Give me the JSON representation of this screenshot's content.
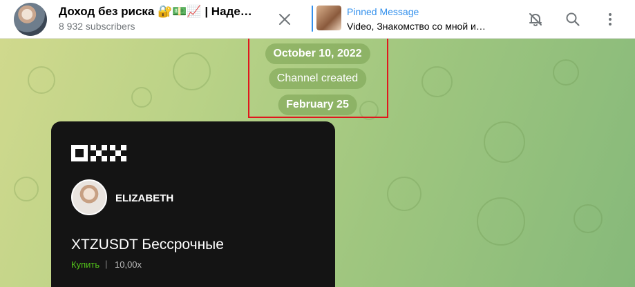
{
  "header": {
    "title": "Доход без риска 🔐💵📈 | Наде…",
    "subscribers": "8 932 subscribers",
    "pinned_label": "Pinned Message",
    "pinned_text": "Video, Знакомство со мной и…"
  },
  "service": {
    "date1": "October 10, 2022",
    "created": "Channel created",
    "date2": "February 25"
  },
  "card": {
    "brand": "OKX",
    "name": "ELIZABETH",
    "pair": "XTZUSDT Бессрочные",
    "side": "Купить",
    "separator": "|",
    "leverage": "10,00x"
  },
  "colors": {
    "accent": "#3390ec",
    "highlight": "#e0171d",
    "buy": "#52c41a"
  }
}
